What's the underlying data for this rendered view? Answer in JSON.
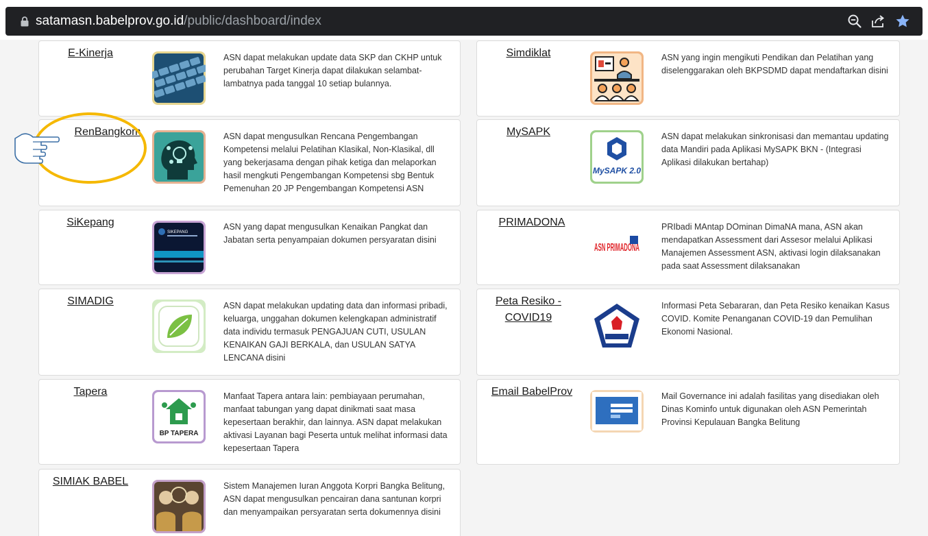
{
  "browser": {
    "url_host": "satamasn.babelprov.go.id",
    "url_path": "/public/dashboard/index",
    "icons": [
      "lock-icon",
      "zoom-icon",
      "share-icon",
      "bookmark-star-icon"
    ]
  },
  "cards": [
    {
      "id": "ekinerja",
      "title": "E-Kinerja",
      "icon": "keyboard-image",
      "description": "ASN dapat melakukan update data SKP dan CKHP untuk perubahan Target Kinerja dapat dilakukan selambat-lambatnya pada tanggal 10 setiap bulannya."
    },
    {
      "id": "simdiklat",
      "title": "Simdiklat",
      "icon": "training-class-image",
      "description": "ASN yang ingin mengikuti Pendikan dan Pelatihan yang diselenggarakan oleh BKPSDMD dapat mendaftarkan disini"
    },
    {
      "id": "renbangkom",
      "title": "RenBangkom",
      "icon": "head-lightbulb-image",
      "description": "ASN dapat mengusulkan Rencana Pengembangan Kompetensi melalui Pelatihan Klasikal, Non-Klasikal, dll yang bekerjasama dengan pihak ketiga dan melaporkan hasil mengkuti Pengembangan Kompetensi sbg Bentuk Pemenuhan 20 JP Pengembangan Kompetensi ASN"
    },
    {
      "id": "mysapk",
      "title": "MySAPK",
      "icon": "mysapk-logo",
      "logo_text": "MySAPK 2.0",
      "description": "ASN dapat melakukan sinkronisasi dan memantau updating data Mandiri pada Aplikasi MySAPK BKN - (Integrasi Aplikasi dilakukan bertahap)"
    },
    {
      "id": "sikepang",
      "title": "SiKepang",
      "icon": "sikepang-screen-image",
      "logo_text": "SIKEPANG",
      "description": "ASN yang dapat mengusulkan Kenaikan Pangkat dan Jabatan serta penyampaian dokumen persyaratan disini"
    },
    {
      "id": "primadona",
      "title": "PRIMADONA",
      "icon": "primadona-logo",
      "logo_text": "ASN PRIMADONA",
      "description": "PRIbadi MAntap DOminan DimaNA mana, ASN akan mendapatkan Assessment dari Assesor melalui Aplikasi Manajemen Assessment ASN, aktivasi login dilaksanakan pada saat Assessment dilaksanakan"
    },
    {
      "id": "simadig",
      "title": "SIMADIG",
      "icon": "leaf-icon",
      "description": "ASN dapat melakukan updating data dan informasi pribadi, keluarga, unggahan dokumen kelengkapan administratif data individu termasuk PENGAJUAN CUTI, USULAN KENAIKAN GAJI BERKALA, dan USULAN SATYA LENCANA disini"
    },
    {
      "id": "covid",
      "title": "Peta Resiko - COVID19",
      "icon": "covid-task-force-logo",
      "description": "Informasi Peta Sebararan, dan Peta Resiko kenaikan Kasus COVID. Komite Penanganan COVID-19 dan Pemulihan Ekonomi Nasional."
    },
    {
      "id": "tapera",
      "title": "Tapera",
      "icon": "tapera-logo",
      "logo_text": "BP TAPERA",
      "description": "Manfaat Tapera antara lain: pembiayaan perumahan, manfaat tabungan yang dapat dinikmati saat masa kepesertaan berakhir, dan lainnya. ASN dapat melakukan aktivasi Layanan bagi Peserta untuk melihat informasi data kepesertaan Tapera"
    },
    {
      "id": "email",
      "title": "Email BabelProv",
      "icon": "email-login-image",
      "description": "Mail Governance ini adalah fasilitas yang disediakan oleh Dinas Kominfo untuk digunakan oleh ASN Pemerintah Provinsi Kepulauan Bangka Belitung"
    },
    {
      "id": "simiak",
      "title": "SIMIAK BABEL",
      "icon": "korpri-photo-image",
      "description": "Sistem Manajemen Iuran Anggota Korpri Bangka Belitung, ASN dapat mengusulkan pencairan dana santunan korpri dan menyampaikan persyaratan serta dokumennya disini"
    }
  ],
  "annotation": {
    "icon": "pointing-hand-icon",
    "highlight": "yellow circle around RenBangkom"
  }
}
